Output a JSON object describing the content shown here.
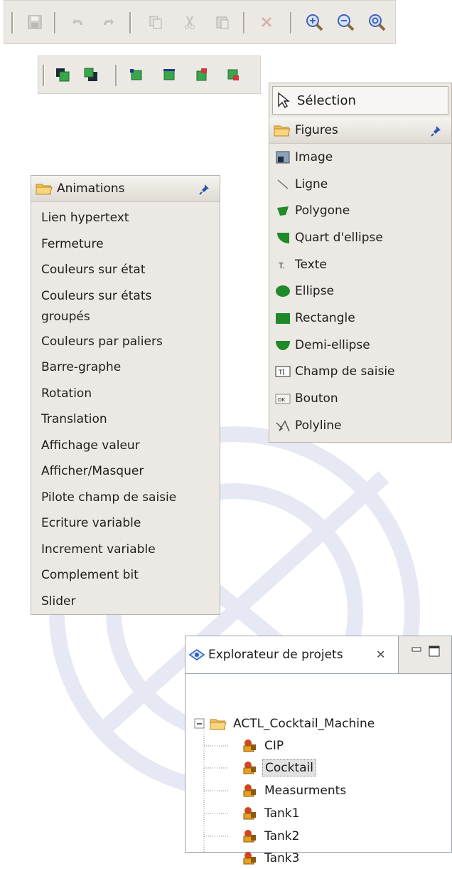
{
  "toolbar_top": {
    "buttons": [
      {
        "icon": "save-icon"
      },
      {
        "icon": "undo-icon"
      },
      {
        "icon": "redo-icon"
      },
      {
        "icon": "copy-icon"
      },
      {
        "icon": "cut-icon"
      },
      {
        "icon": "paste-icon"
      },
      {
        "icon": "delete-icon"
      },
      {
        "icon": "zoom-in-icon"
      },
      {
        "icon": "zoom-out-icon"
      },
      {
        "icon": "zoom-fit-icon"
      }
    ]
  },
  "toolbar_layers": {
    "buttons": [
      {
        "icon": "bring-to-front-icon"
      },
      {
        "icon": "send-to-back-icon"
      },
      {
        "icon": "align-left-icon"
      },
      {
        "icon": "align-right-icon"
      },
      {
        "icon": "align-top-icon"
      },
      {
        "icon": "align-bottom-icon"
      }
    ]
  },
  "animations": {
    "title": "Animations",
    "items": [
      "Lien hypertext",
      "Fermeture",
      "Couleurs sur état",
      "Couleurs sur états groupés",
      "Couleurs par paliers",
      "Barre-graphe",
      "Rotation",
      "Translation",
      "Affichage valeur",
      "Afficher/Masquer",
      "Pilote champ de saisie",
      "Ecriture variable",
      "Increment variable",
      "Complement bit",
      "Slider"
    ]
  },
  "figures": {
    "selection_label": "Sélection",
    "title": "Figures",
    "items": [
      {
        "label": "Image",
        "icon": "image-icon"
      },
      {
        "label": "Ligne",
        "icon": "line-icon"
      },
      {
        "label": "Polygone",
        "icon": "polygon-icon"
      },
      {
        "label": "Quart d'ellipse",
        "icon": "quarter-ellipse-icon"
      },
      {
        "label": "Texte",
        "icon": "text-icon"
      },
      {
        "label": "Ellipse",
        "icon": "ellipse-icon"
      },
      {
        "label": "Rectangle",
        "icon": "rectangle-icon"
      },
      {
        "label": "Demi-ellipse",
        "icon": "half-ellipse-icon"
      },
      {
        "label": "Champ de saisie",
        "icon": "input-field-icon"
      },
      {
        "label": "Bouton",
        "icon": "button-icon"
      },
      {
        "label": "Polyline",
        "icon": "polyline-icon"
      }
    ],
    "accent_green": "#1f8a2a"
  },
  "explorer": {
    "tab_title": "Explorateur de projets",
    "close_symbol": "✕",
    "project": "ACTL_Cocktail_Machine",
    "children": [
      "CIP",
      "Cocktail",
      "Measurments",
      "Tank1",
      "Tank2",
      "Tank3"
    ],
    "selected": "Cocktail"
  }
}
